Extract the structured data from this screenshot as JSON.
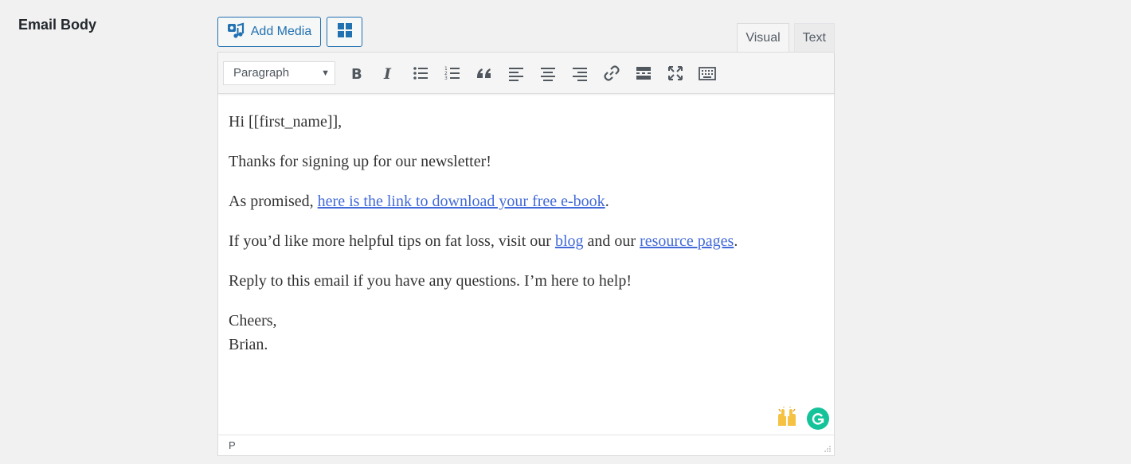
{
  "field_label": "Email Body",
  "media_button": {
    "label": "Add Media",
    "icon": "add-media-icon"
  },
  "grid_button": {
    "icon": "grid-icon"
  },
  "tabs": [
    {
      "label": "Visual",
      "active": true
    },
    {
      "label": "Text",
      "active": false
    }
  ],
  "toolbar": {
    "format_value": "Paragraph",
    "buttons": [
      "bold-icon",
      "italic-icon",
      "bullet-list-icon",
      "numbered-list-icon",
      "blockquote-icon",
      "align-left-icon",
      "align-center-icon",
      "align-right-icon",
      "link-icon",
      "read-more-icon",
      "fullscreen-icon",
      "toolbar-toggle-icon"
    ]
  },
  "content": {
    "greeting": "Hi [[first_name]],",
    "line1": "Thanks for signing up for our newsletter!",
    "line2_prefix": "As promised, ",
    "line2_link": "here is the link to download your free e-book",
    "line2_suffix": ".",
    "line3_prefix": "If you’d like more helpful tips on fat loss, visit our ",
    "line3_link1": "blog",
    "line3_mid": " and our ",
    "line3_link2": "resource pages",
    "line3_suffix": ".",
    "line4": "Reply to this email if you have any questions. I’m here to help!",
    "closing": "Cheers,",
    "signature": "Brian."
  },
  "statusbar": {
    "path": "P"
  },
  "colors": {
    "accent": "#2271b1",
    "link": "#4269d8",
    "grammarly": "#15c39a"
  }
}
